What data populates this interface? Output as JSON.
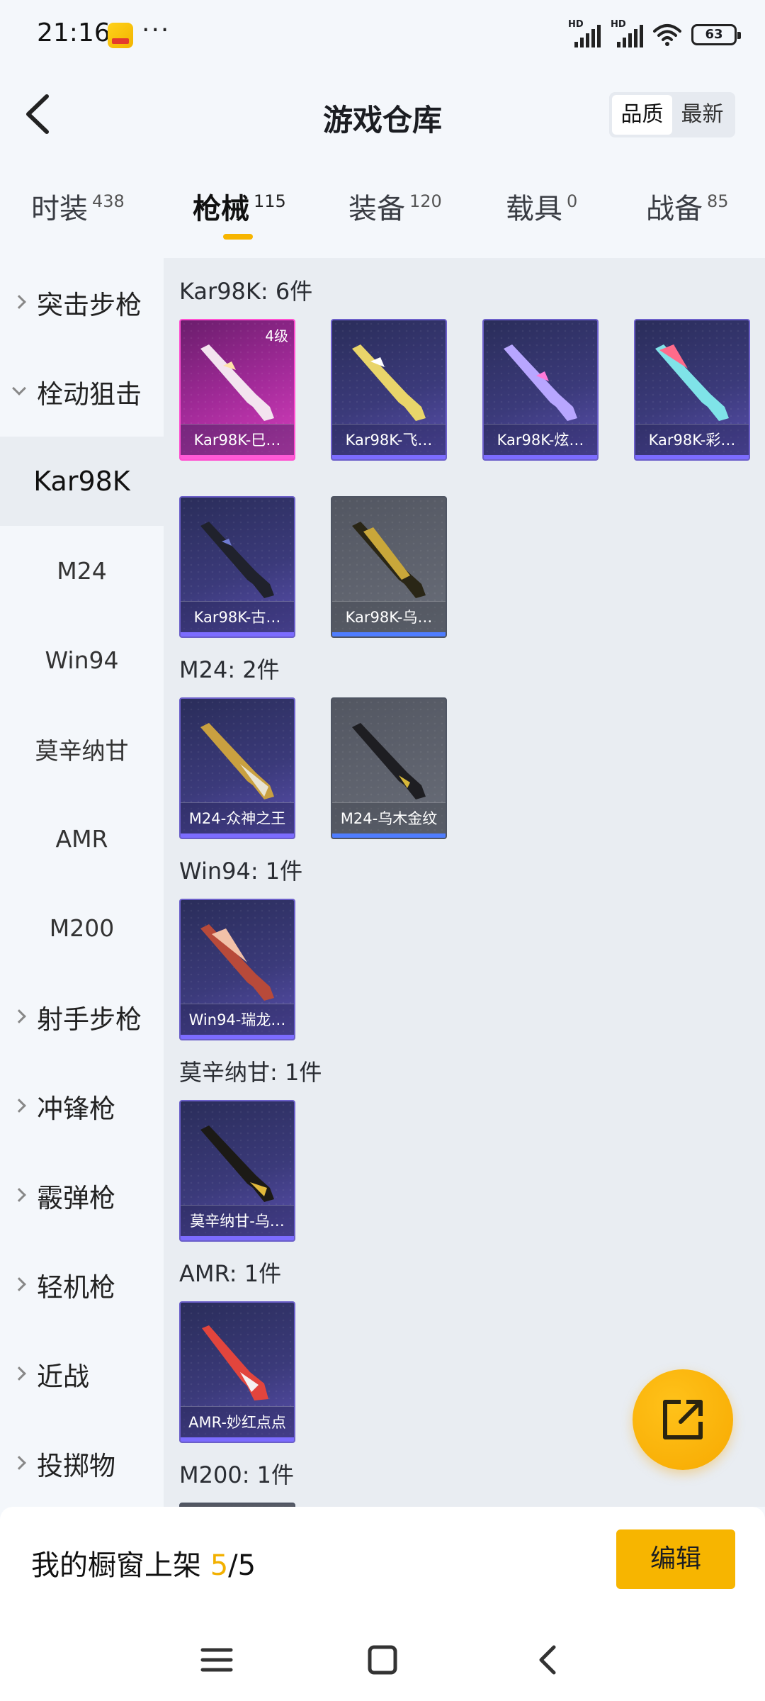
{
  "status_bar": {
    "time": "21:16",
    "app_icon": "app-notification-icon",
    "more": "···",
    "signal1_label": "HD",
    "signal2_label": "HD",
    "battery": "63"
  },
  "header": {
    "title": "游戏仓库",
    "sort_options": [
      "品质",
      "最新"
    ],
    "sort_selected": "品质"
  },
  "tabs": [
    {
      "label": "时装",
      "count": "438"
    },
    {
      "label": "枪械",
      "count": "115"
    },
    {
      "label": "装备",
      "count": "120"
    },
    {
      "label": "载具",
      "count": "0"
    },
    {
      "label": "战备",
      "count": "85"
    }
  ],
  "active_tab": "枪械",
  "sidebar": {
    "groups": [
      {
        "label": "突击步枪"
      },
      {
        "label": "栓动狙击"
      },
      {
        "label": "射手步枪"
      },
      {
        "label": "冲锋枪"
      },
      {
        "label": "霰弹枪"
      },
      {
        "label": "轻机枪"
      },
      {
        "label": "近战"
      },
      {
        "label": "投掷物"
      }
    ],
    "sub_items": [
      "Kar98K",
      "M24",
      "Win94",
      "莫辛纳甘",
      "AMR",
      "M200"
    ],
    "active_sub": "Kar98K"
  },
  "sections": [
    {
      "title": "Kar98K: 6件",
      "items": [
        {
          "label": "Kar98K-巳…",
          "level": "4级",
          "rarity": "pink"
        },
        {
          "label": "Kar98K-飞…",
          "rarity": "purple"
        },
        {
          "label": "Kar98K-炫…",
          "rarity": "purple"
        },
        {
          "label": "Kar98K-彩…",
          "rarity": "purple"
        },
        {
          "label": "Kar98K-古…",
          "rarity": "purple"
        },
        {
          "label": "Kar98K-乌…",
          "rarity": "gray"
        }
      ]
    },
    {
      "title": "M24: 2件",
      "items": [
        {
          "label": "M24-众神之王",
          "rarity": "purple"
        },
        {
          "label": "M24-乌木金纹",
          "rarity": "gray"
        }
      ]
    },
    {
      "title": "Win94: 1件",
      "items": [
        {
          "label": "Win94-瑞龙…",
          "rarity": "purple"
        }
      ]
    },
    {
      "title": "莫辛纳甘: 1件",
      "items": [
        {
          "label": "莫辛纳甘-乌…",
          "rarity": "purple"
        }
      ]
    },
    {
      "title": "AMR: 1件",
      "items": [
        {
          "label": "AMR-妙红点点",
          "rarity": "purple"
        }
      ]
    },
    {
      "title": "M200: 1件",
      "items": []
    }
  ],
  "bottom": {
    "showcase_prefix": "我的橱窗上架",
    "showcase_current": "5",
    "showcase_total": "/5",
    "edit_label": "编辑"
  },
  "colors": {
    "accent": "#f7b500",
    "rarity_pink": "#ff4fd0",
    "rarity_purple": "#6b5fc9",
    "rarity_gray": "#4f5563"
  },
  "icons": {
    "back": "back-arrow-icon",
    "share": "share-export-icon",
    "nav_menu": "menu-icon",
    "nav_home": "home-square-icon",
    "nav_back": "nav-back-icon"
  }
}
